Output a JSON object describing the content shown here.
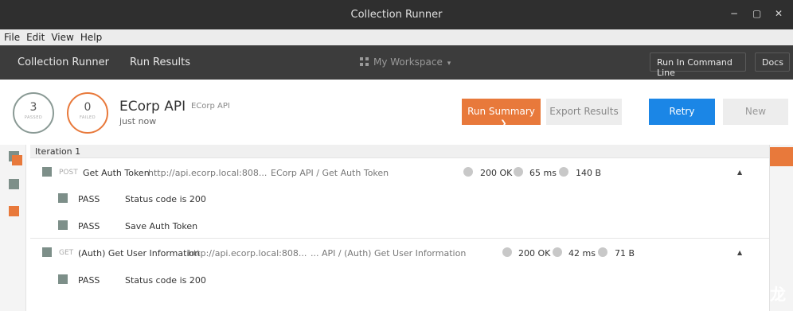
{
  "window": {
    "title": "Collection Runner",
    "controls": {
      "minimize": "−",
      "maximize": "▢",
      "close": "✕"
    }
  },
  "menu": [
    "File",
    "Edit",
    "View",
    "Help"
  ],
  "appbar": {
    "tabs": [
      "Collection Runner",
      "Run Results"
    ],
    "workspace": "My Workspace",
    "workspace_caret": "▾",
    "run_cli_label": "Run In Command Line",
    "docs_label": "Docs"
  },
  "summary": {
    "passed_count": "3",
    "passed_label": "PASSED",
    "failed_count": "0",
    "failed_label": "FAILED",
    "collection_name": "ECorp API",
    "collection_env": "ECorp API",
    "time": "just now",
    "run_summary_label": "Run Summary",
    "run_summary_chevron": "❯",
    "export_label": "Export Results",
    "retry_label": "Retry",
    "new_label": "New"
  },
  "colors": {
    "accent_orange": "#e8793b",
    "retry_blue": "#1b86e6",
    "pass_gray": "#7d8f89"
  },
  "iteration": {
    "label": "Iteration 1"
  },
  "requests": [
    {
      "method": "POST",
      "name": "Get Auth Token",
      "url": "http://api.ecorp.local:808...",
      "path": "ECorp API / Get Auth Token",
      "status": "200 OK",
      "time": "65 ms",
      "size": "140 B",
      "tests": [
        {
          "result": "PASS",
          "name": "Status code is 200"
        },
        {
          "result": "PASS",
          "name": "Save Auth Token"
        }
      ]
    },
    {
      "method": "GET",
      "name": "(Auth) Get User Information",
      "url": "http://api.ecorp.local:808...",
      "path": "... API / (Auth) Get User Information",
      "status": "200 OK",
      "time": "42 ms",
      "size": "71 B",
      "tests": [
        {
          "result": "PASS",
          "name": "Status code is 200"
        }
      ]
    }
  ],
  "collapse_caret": "▲",
  "watermark": "掘金技术社区 @ 布客飞龙"
}
